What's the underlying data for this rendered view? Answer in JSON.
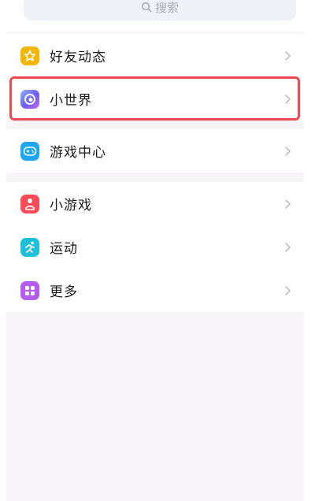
{
  "search": {
    "placeholder": "搜索"
  },
  "groups": [
    {
      "items": [
        {
          "label": "好友动态",
          "icon": "star-icon",
          "color": "#f5b600"
        },
        {
          "label": "小世界",
          "icon": "little-world-icon",
          "color": "#6a5cf0"
        }
      ]
    },
    {
      "items": [
        {
          "label": "游戏中心",
          "icon": "gamepad-icon",
          "color": "#1fa6f2"
        }
      ]
    },
    {
      "items": [
        {
          "label": "小游戏",
          "icon": "mini-game-icon",
          "color": "#ff4a5a"
        },
        {
          "label": "运动",
          "icon": "running-icon",
          "color": "#1ec0d8"
        },
        {
          "label": "更多",
          "icon": "grid-more-icon",
          "color": "#b45cf2"
        }
      ]
    }
  ],
  "highlight": {
    "color": "#e84b51",
    "target": "小世界"
  }
}
